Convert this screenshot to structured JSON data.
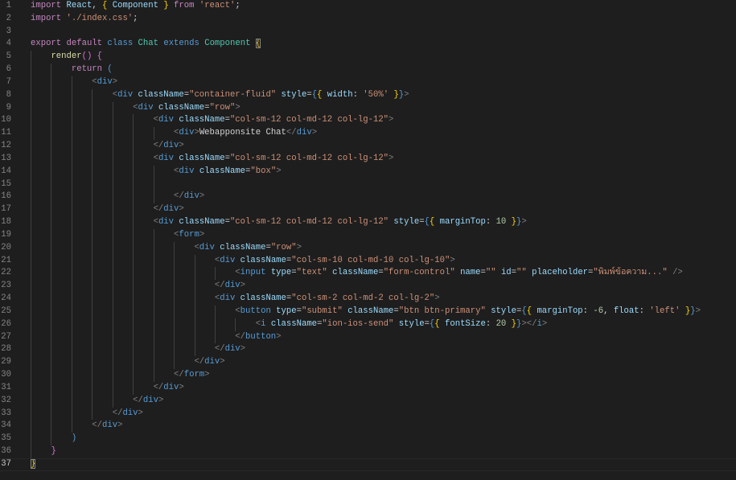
{
  "editor": {
    "theme_colors": {
      "background": "#1e1e1e",
      "keyword": "#c586c0",
      "tag": "#569cd6",
      "type": "#4ec9b0",
      "string": "#ce9178",
      "attribute": "#9cdcfe"
    },
    "current_line": 37,
    "lines": [
      [
        [
          "k",
          "import"
        ],
        [
          "x",
          " "
        ],
        [
          "v",
          "React"
        ],
        [
          "x",
          ", "
        ],
        [
          "y",
          "{"
        ],
        [
          "x",
          " "
        ],
        [
          "v",
          "Component"
        ],
        [
          "x",
          " "
        ],
        [
          "y",
          "}"
        ],
        [
          "x",
          " "
        ],
        [
          "k",
          "from"
        ],
        [
          "x",
          " "
        ],
        [
          "s",
          "'react'"
        ],
        [
          "x",
          ";"
        ]
      ],
      [
        [
          "k",
          "import"
        ],
        [
          "x",
          " "
        ],
        [
          "s",
          "'./index.css'"
        ],
        [
          "x",
          ";"
        ]
      ],
      [],
      [
        [
          "k",
          "export"
        ],
        [
          "x",
          " "
        ],
        [
          "k",
          "default"
        ],
        [
          "x",
          " "
        ],
        [
          "b",
          "class"
        ],
        [
          "x",
          " "
        ],
        [
          "t",
          "Chat"
        ],
        [
          "x",
          " "
        ],
        [
          "b",
          "extends"
        ],
        [
          "x",
          " "
        ],
        [
          "t",
          "Component"
        ],
        [
          "x",
          " "
        ],
        [
          "ym",
          "{"
        ]
      ],
      [
        [
          "x",
          "    "
        ],
        [
          "f",
          "render"
        ],
        [
          "z",
          "()"
        ],
        [
          "x",
          " "
        ],
        [
          "z",
          "{"
        ]
      ],
      [
        [
          "x",
          "        "
        ],
        [
          "k",
          "return"
        ],
        [
          "x",
          " "
        ],
        [
          "b",
          "("
        ]
      ],
      [
        [
          "x",
          "            "
        ],
        [
          "p",
          "<"
        ],
        [
          "b",
          "div"
        ],
        [
          "p",
          ">"
        ]
      ],
      [
        [
          "x",
          "                "
        ],
        [
          "p",
          "<"
        ],
        [
          "b",
          "div"
        ],
        [
          "x",
          " "
        ],
        [
          "a",
          "className"
        ],
        [
          "x",
          "="
        ],
        [
          "s",
          "\"container-fluid\""
        ],
        [
          "x",
          " "
        ],
        [
          "a",
          "style"
        ],
        [
          "x",
          "="
        ],
        [
          "b",
          "{"
        ],
        [
          "y",
          "{"
        ],
        [
          "x",
          " "
        ],
        [
          "v",
          "width"
        ],
        [
          "x",
          ": "
        ],
        [
          "s",
          "'50%'"
        ],
        [
          "x",
          " "
        ],
        [
          "y",
          "}"
        ],
        [
          "b",
          "}"
        ],
        [
          "p",
          ">"
        ]
      ],
      [
        [
          "x",
          "                    "
        ],
        [
          "p",
          "<"
        ],
        [
          "b",
          "div"
        ],
        [
          "x",
          " "
        ],
        [
          "a",
          "className"
        ],
        [
          "x",
          "="
        ],
        [
          "s",
          "\"row\""
        ],
        [
          "p",
          ">"
        ]
      ],
      [
        [
          "x",
          "                        "
        ],
        [
          "p",
          "<"
        ],
        [
          "b",
          "div"
        ],
        [
          "x",
          " "
        ],
        [
          "a",
          "className"
        ],
        [
          "x",
          "="
        ],
        [
          "s",
          "\"col-sm-12 col-md-12 col-lg-12\""
        ],
        [
          "p",
          ">"
        ]
      ],
      [
        [
          "x",
          "                            "
        ],
        [
          "p",
          "<"
        ],
        [
          "b",
          "div"
        ],
        [
          "p",
          ">"
        ],
        [
          "x",
          "Webapponsite Chat"
        ],
        [
          "p",
          "</"
        ],
        [
          "b",
          "div"
        ],
        [
          "p",
          ">"
        ]
      ],
      [
        [
          "x",
          "                        "
        ],
        [
          "p",
          "</"
        ],
        [
          "b",
          "div"
        ],
        [
          "p",
          ">"
        ]
      ],
      [
        [
          "x",
          "                        "
        ],
        [
          "p",
          "<"
        ],
        [
          "b",
          "div"
        ],
        [
          "x",
          " "
        ],
        [
          "a",
          "className"
        ],
        [
          "x",
          "="
        ],
        [
          "s",
          "\"col-sm-12 col-md-12 col-lg-12\""
        ],
        [
          "p",
          ">"
        ]
      ],
      [
        [
          "x",
          "                            "
        ],
        [
          "p",
          "<"
        ],
        [
          "b",
          "div"
        ],
        [
          "x",
          " "
        ],
        [
          "a",
          "className"
        ],
        [
          "x",
          "="
        ],
        [
          "s",
          "\"box\""
        ],
        [
          "p",
          ">"
        ]
      ],
      [],
      [
        [
          "x",
          "                            "
        ],
        [
          "p",
          "</"
        ],
        [
          "b",
          "div"
        ],
        [
          "p",
          ">"
        ]
      ],
      [
        [
          "x",
          "                        "
        ],
        [
          "p",
          "</"
        ],
        [
          "b",
          "div"
        ],
        [
          "p",
          ">"
        ]
      ],
      [
        [
          "x",
          "                        "
        ],
        [
          "p",
          "<"
        ],
        [
          "b",
          "div"
        ],
        [
          "x",
          " "
        ],
        [
          "a",
          "className"
        ],
        [
          "x",
          "="
        ],
        [
          "s",
          "\"col-sm-12 col-md-12 col-lg-12\""
        ],
        [
          "x",
          " "
        ],
        [
          "a",
          "style"
        ],
        [
          "x",
          "="
        ],
        [
          "b",
          "{"
        ],
        [
          "y",
          "{"
        ],
        [
          "x",
          " "
        ],
        [
          "v",
          "marginTop"
        ],
        [
          "x",
          ": "
        ],
        [
          "n",
          "10"
        ],
        [
          "x",
          " "
        ],
        [
          "y",
          "}"
        ],
        [
          "b",
          "}"
        ],
        [
          "p",
          ">"
        ]
      ],
      [
        [
          "x",
          "                            "
        ],
        [
          "p",
          "<"
        ],
        [
          "b",
          "form"
        ],
        [
          "p",
          ">"
        ]
      ],
      [
        [
          "x",
          "                                "
        ],
        [
          "p",
          "<"
        ],
        [
          "b",
          "div"
        ],
        [
          "x",
          " "
        ],
        [
          "a",
          "className"
        ],
        [
          "x",
          "="
        ],
        [
          "s",
          "\"row\""
        ],
        [
          "p",
          ">"
        ]
      ],
      [
        [
          "x",
          "                                    "
        ],
        [
          "p",
          "<"
        ],
        [
          "b",
          "div"
        ],
        [
          "x",
          " "
        ],
        [
          "a",
          "className"
        ],
        [
          "x",
          "="
        ],
        [
          "s",
          "\"col-sm-10 col-md-10 col-lg-10\""
        ],
        [
          "p",
          ">"
        ]
      ],
      [
        [
          "x",
          "                                        "
        ],
        [
          "p",
          "<"
        ],
        [
          "b",
          "input"
        ],
        [
          "x",
          " "
        ],
        [
          "a",
          "type"
        ],
        [
          "x",
          "="
        ],
        [
          "s",
          "\"text\""
        ],
        [
          "x",
          " "
        ],
        [
          "a",
          "className"
        ],
        [
          "x",
          "="
        ],
        [
          "s",
          "\"form-control\""
        ],
        [
          "x",
          " "
        ],
        [
          "a",
          "name"
        ],
        [
          "x",
          "="
        ],
        [
          "s",
          "\"\""
        ],
        [
          "x",
          " "
        ],
        [
          "a",
          "id"
        ],
        [
          "x",
          "="
        ],
        [
          "s",
          "\"\""
        ],
        [
          "x",
          " "
        ],
        [
          "a",
          "placeholder"
        ],
        [
          "x",
          "="
        ],
        [
          "s",
          "\"พิมพ์ข้อความ...\""
        ],
        [
          "x",
          " "
        ],
        [
          "p",
          "/>"
        ]
      ],
      [
        [
          "x",
          "                                    "
        ],
        [
          "p",
          "</"
        ],
        [
          "b",
          "div"
        ],
        [
          "p",
          ">"
        ]
      ],
      [
        [
          "x",
          "                                    "
        ],
        [
          "p",
          "<"
        ],
        [
          "b",
          "div"
        ],
        [
          "x",
          " "
        ],
        [
          "a",
          "className"
        ],
        [
          "x",
          "="
        ],
        [
          "s",
          "\"col-sm-2 col-md-2 col-lg-2\""
        ],
        [
          "p",
          ">"
        ]
      ],
      [
        [
          "x",
          "                                        "
        ],
        [
          "p",
          "<"
        ],
        [
          "b",
          "button"
        ],
        [
          "x",
          " "
        ],
        [
          "a",
          "type"
        ],
        [
          "x",
          "="
        ],
        [
          "s",
          "\"submit\""
        ],
        [
          "x",
          " "
        ],
        [
          "a",
          "className"
        ],
        [
          "x",
          "="
        ],
        [
          "s",
          "\"btn btn-primary\""
        ],
        [
          "x",
          " "
        ],
        [
          "a",
          "style"
        ],
        [
          "x",
          "="
        ],
        [
          "b",
          "{"
        ],
        [
          "y",
          "{"
        ],
        [
          "x",
          " "
        ],
        [
          "v",
          "marginTop"
        ],
        [
          "x",
          ": "
        ],
        [
          "n",
          "-6"
        ],
        [
          "x",
          ", "
        ],
        [
          "v",
          "float"
        ],
        [
          "x",
          ": "
        ],
        [
          "s",
          "'left'"
        ],
        [
          "x",
          " "
        ],
        [
          "y",
          "}"
        ],
        [
          "b",
          "}"
        ],
        [
          "p",
          ">"
        ]
      ],
      [
        [
          "x",
          "                                            "
        ],
        [
          "p",
          "<"
        ],
        [
          "b",
          "i"
        ],
        [
          "x",
          " "
        ],
        [
          "a",
          "className"
        ],
        [
          "x",
          "="
        ],
        [
          "s",
          "\"ion-ios-send\""
        ],
        [
          "x",
          " "
        ],
        [
          "a",
          "style"
        ],
        [
          "x",
          "="
        ],
        [
          "b",
          "{"
        ],
        [
          "y",
          "{"
        ],
        [
          "x",
          " "
        ],
        [
          "v",
          "fontSize"
        ],
        [
          "x",
          ": "
        ],
        [
          "n",
          "20"
        ],
        [
          "x",
          " "
        ],
        [
          "y",
          "}"
        ],
        [
          "b",
          "}"
        ],
        [
          "p",
          "></"
        ],
        [
          "b",
          "i"
        ],
        [
          "p",
          ">"
        ]
      ],
      [
        [
          "x",
          "                                        "
        ],
        [
          "p",
          "</"
        ],
        [
          "b",
          "button"
        ],
        [
          "p",
          ">"
        ]
      ],
      [
        [
          "x",
          "                                    "
        ],
        [
          "p",
          "</"
        ],
        [
          "b",
          "div"
        ],
        [
          "p",
          ">"
        ]
      ],
      [
        [
          "x",
          "                                "
        ],
        [
          "p",
          "</"
        ],
        [
          "b",
          "div"
        ],
        [
          "p",
          ">"
        ]
      ],
      [
        [
          "x",
          "                            "
        ],
        [
          "p",
          "</"
        ],
        [
          "b",
          "form"
        ],
        [
          "p",
          ">"
        ]
      ],
      [
        [
          "x",
          "                        "
        ],
        [
          "p",
          "</"
        ],
        [
          "b",
          "div"
        ],
        [
          "p",
          ">"
        ]
      ],
      [
        [
          "x",
          "                    "
        ],
        [
          "p",
          "</"
        ],
        [
          "b",
          "div"
        ],
        [
          "p",
          ">"
        ]
      ],
      [
        [
          "x",
          "                "
        ],
        [
          "p",
          "</"
        ],
        [
          "b",
          "div"
        ],
        [
          "p",
          ">"
        ]
      ],
      [
        [
          "x",
          "            "
        ],
        [
          "p",
          "</"
        ],
        [
          "b",
          "div"
        ],
        [
          "p",
          ">"
        ]
      ],
      [
        [
          "x",
          "        "
        ],
        [
          "b",
          ")"
        ]
      ],
      [
        [
          "x",
          "    "
        ],
        [
          "z",
          "}"
        ]
      ],
      [
        [
          "ym",
          "}"
        ]
      ]
    ]
  }
}
